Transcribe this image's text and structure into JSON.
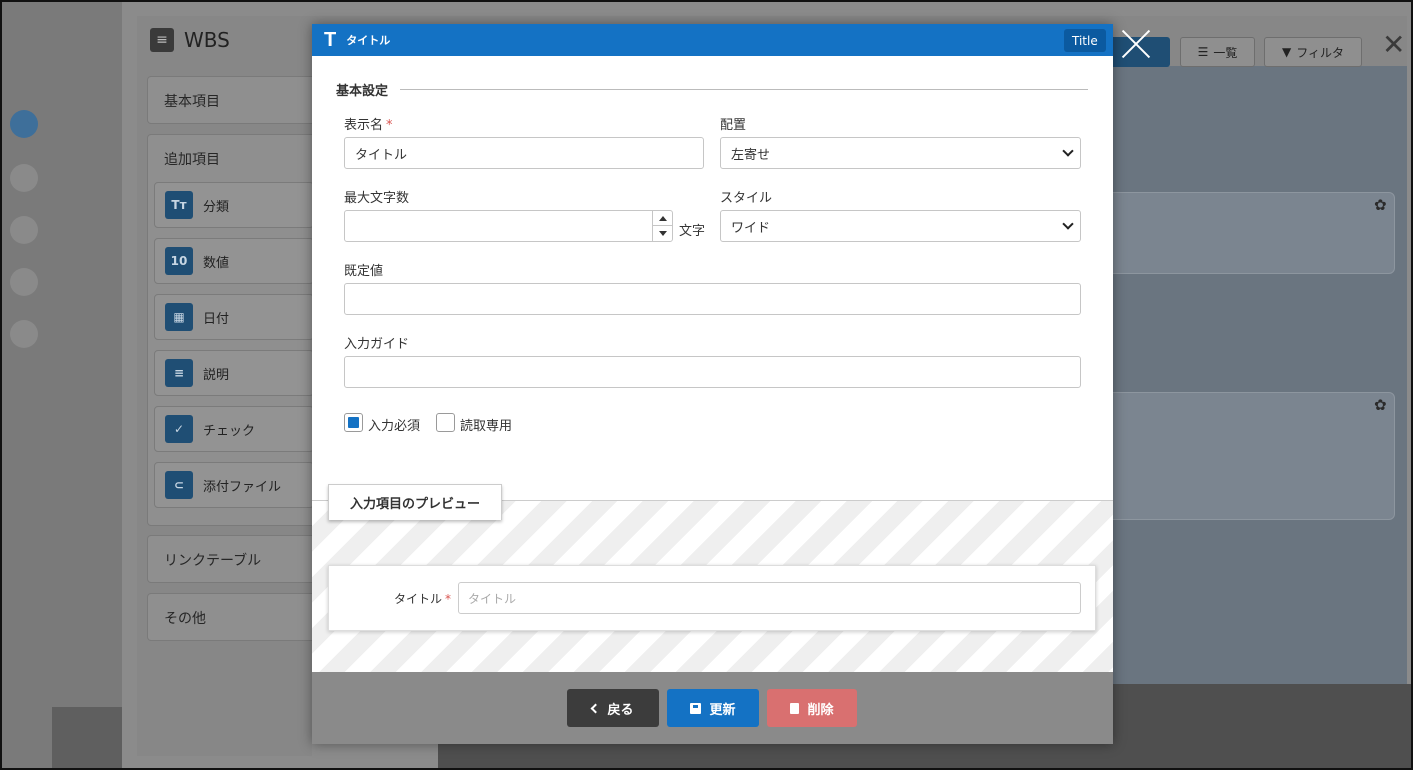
{
  "background": {
    "app_title": "WBS",
    "left_cards": [
      {
        "label": "基本項目"
      },
      {
        "label": "追加項目"
      },
      {
        "label": "リンクテーブル"
      },
      {
        "label": "その他"
      }
    ],
    "field_types": [
      {
        "label": "分類",
        "icon": "text-type-icon",
        "glyph": "Tт"
      },
      {
        "label": "数値",
        "icon": "number-icon",
        "glyph": "10"
      },
      {
        "label": "日付",
        "icon": "calendar-icon",
        "glyph": "▦"
      },
      {
        "label": "説明",
        "icon": "description-icon",
        "glyph": "≡"
      },
      {
        "label": "チェック",
        "icon": "check-icon",
        "glyph": "✓"
      },
      {
        "label": "添付ファイル",
        "icon": "paperclip-icon",
        "glyph": "⊂"
      }
    ],
    "toolbar": {
      "list_label": "一覧",
      "filter_label": "フィルタ"
    }
  },
  "modal": {
    "header_title": "タイトル",
    "header_icon_glyph": "T",
    "badge": "Title",
    "section_title": "基本設定",
    "fields": {
      "display_name": {
        "label": "表示名",
        "value": "タイトル",
        "required_mark": "*"
      },
      "alignment": {
        "label": "配置",
        "value": "左寄せ"
      },
      "max_chars": {
        "label": "最大文字数",
        "value": "",
        "unit": "文字"
      },
      "style": {
        "label": "スタイル",
        "value": "ワイド"
      },
      "default_value": {
        "label": "既定値",
        "value": ""
      },
      "input_guide": {
        "label": "入力ガイド",
        "value": ""
      }
    },
    "checkboxes": {
      "required": {
        "label": "入力必須",
        "checked": true
      },
      "readonly": {
        "label": "読取専用",
        "checked": false
      }
    },
    "preview": {
      "tab_label": "入力項目のプレビュー",
      "field_label": "タイトル",
      "required_mark": "*",
      "placeholder": "タイトル"
    },
    "footer": {
      "back_label": "戻る",
      "save_label": "更新",
      "delete_label": "削除"
    }
  },
  "colors": {
    "primary": "#1472c4",
    "danger": "#d97070",
    "dark": "#3c3c3c"
  }
}
